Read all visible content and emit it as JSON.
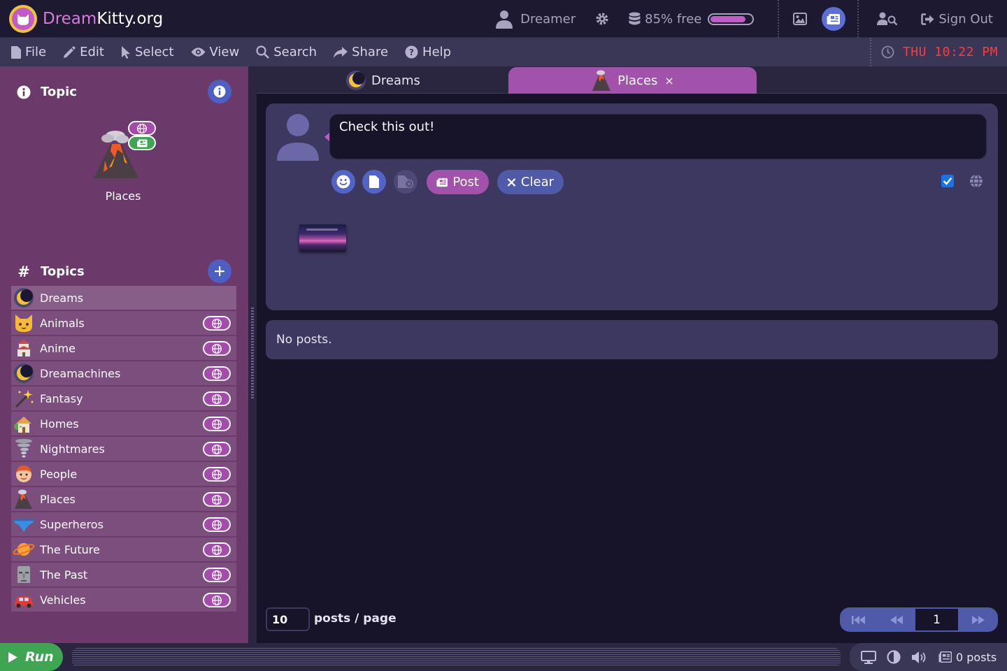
{
  "app": {
    "logo_part1": "Dream",
    "logo_part2": "Kitty.org"
  },
  "topbar": {
    "user_name": "Dreamer",
    "storage_text": "85% free",
    "storage_free_percent": 85,
    "sign_out_label": "Sign Out"
  },
  "menu": {
    "file": "File",
    "edit": "Edit",
    "select": "Select",
    "view": "View",
    "search": "Search",
    "share": "Share",
    "help": "Help",
    "clock": "THU 10:22 PM"
  },
  "sidebar": {
    "topic_heading": "Topic",
    "current_topic": "Places",
    "topics_heading": "Topics",
    "topics": [
      {
        "label": "Dreams",
        "icon": "moon-icon"
      },
      {
        "label": "Animals",
        "icon": "cat-face-icon"
      },
      {
        "label": "Anime",
        "icon": "japanese-castle-icon"
      },
      {
        "label": "Dreamachines",
        "icon": "moon-icon"
      },
      {
        "label": "Fantasy",
        "icon": "magic-wand-icon"
      },
      {
        "label": "Homes",
        "icon": "house-icon"
      },
      {
        "label": "Nightmares",
        "icon": "tornado-icon"
      },
      {
        "label": "People",
        "icon": "person-face-icon"
      },
      {
        "label": "Places",
        "icon": "volcano-icon"
      },
      {
        "label": "Superheros",
        "icon": "briefs-icon"
      },
      {
        "label": "The Future",
        "icon": "ringed-planet-icon"
      },
      {
        "label": "The Past",
        "icon": "moai-icon"
      },
      {
        "label": "Vehicles",
        "icon": "car-icon"
      }
    ]
  },
  "tabs": {
    "dreams": "Dreams",
    "places": "Places",
    "close": "×"
  },
  "composer": {
    "input_value": "Check this out!",
    "post_label": "Post",
    "clear_label": "Clear",
    "public_checked": true
  },
  "feed": {
    "empty_text": "No posts."
  },
  "pager": {
    "per_page": "10",
    "per_page_label": "posts / page",
    "current_page": "1"
  },
  "bottombar": {
    "run_label": "Run",
    "posts_count": "0 posts"
  },
  "colors": {
    "accent_purple": "#a352ab",
    "accent_blue": "#4f5aa8",
    "sidebar_bg": "#6b3a6b",
    "clock_red": "#ff3b3b",
    "run_green": "#3fa553"
  }
}
